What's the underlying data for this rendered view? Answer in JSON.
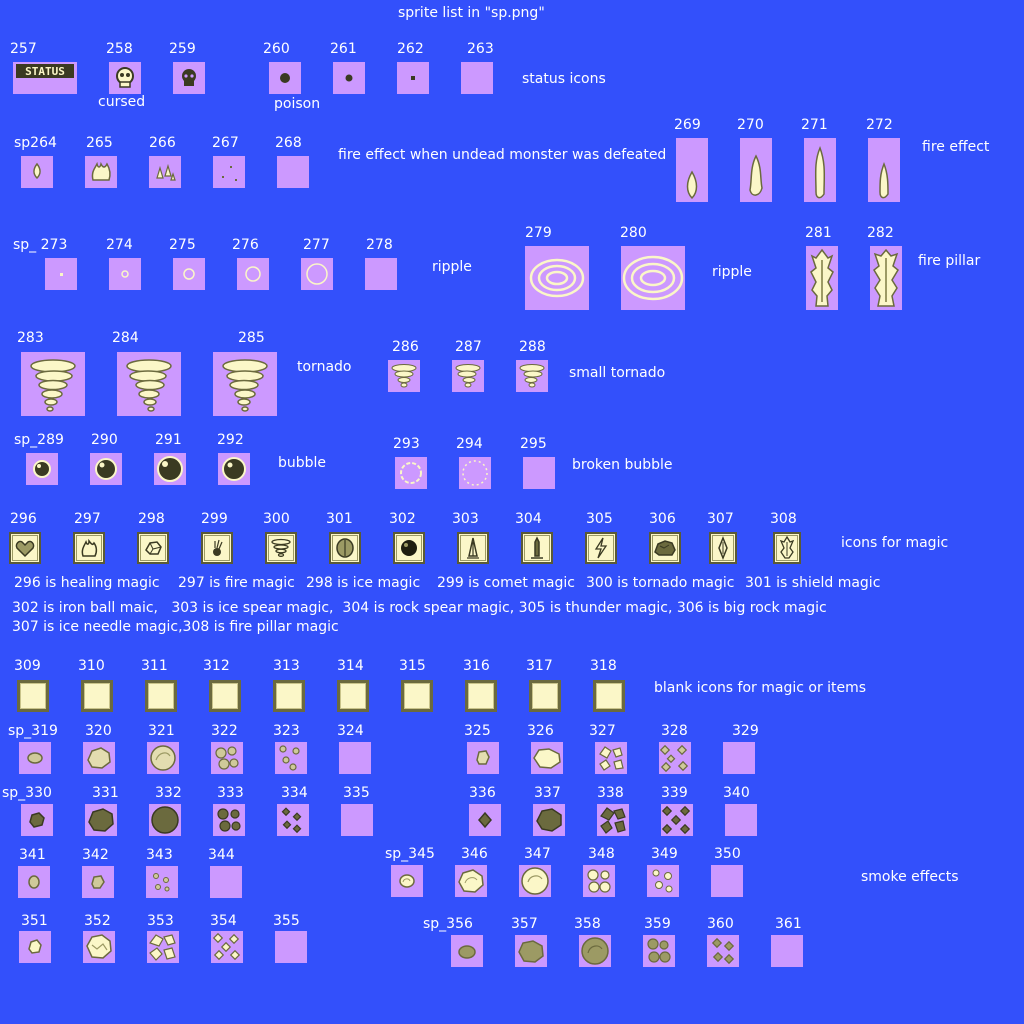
{
  "title": "sprite list in \"sp.png\"",
  "colors": {
    "background": "#3350fb",
    "tile": "#cc99ff",
    "ink": "#3a3a22",
    "pale": "#fbf7c8",
    "olive": "#6b6a3e"
  },
  "sprite_numbers": {
    "n257": "257",
    "n258": "258",
    "n259": "259",
    "n260": "260",
    "n261": "261",
    "n262": "262",
    "n263": "263",
    "n264": "sp264",
    "n265": "265",
    "n266": "266",
    "n267": "267",
    "n268": "268",
    "n269": "269",
    "n270": "270",
    "n271": "271",
    "n272": "272",
    "n273": "sp_ 273",
    "n274": "274",
    "n275": "275",
    "n276": "276",
    "n277": "277",
    "n278": "278",
    "n279": "279",
    "n280": "280",
    "n281": "281",
    "n282": "282",
    "n283": "283",
    "n284": "284",
    "n285": "285",
    "n286": "286",
    "n287": "287",
    "n288": "288",
    "n289": "sp_289",
    "n290": "290",
    "n291": "291",
    "n292": "292",
    "n293": "293",
    "n294": "294",
    "n295": "295",
    "n296": "296",
    "n297": "297",
    "n298": "298",
    "n299": "299",
    "n300": "300",
    "n301": "301",
    "n302": "302",
    "n303": "303",
    "n304": "304",
    "n305": "305",
    "n306": "306",
    "n307": "307",
    "n308": "308",
    "n309": "309",
    "n310": "310",
    "n311": "311",
    "n312": "312",
    "n313": "313",
    "n314": "314",
    "n315": "315",
    "n316": "316",
    "n317": "317",
    "n318": "318",
    "n319": "sp_319",
    "n320": "320",
    "n321": "321",
    "n322": "322",
    "n323": "323",
    "n324": "324",
    "n325": "325",
    "n326": "326",
    "n327": "327",
    "n328": "328",
    "n329": "329",
    "n330": "sp_330",
    "n331": "331",
    "n332": "332",
    "n333": "333",
    "n334": "334",
    "n335": "335",
    "n336": "336",
    "n337": "337",
    "n338": "338",
    "n339": "339",
    "n340": "340",
    "n341": "341",
    "n342": "342",
    "n343": "343",
    "n344": "344",
    "n345": "sp_345",
    "n346": "346",
    "n347": "347",
    "n348": "348",
    "n349": "349",
    "n350": "350",
    "n351": "351",
    "n352": "352",
    "n353": "353",
    "n354": "354",
    "n355": "355",
    "n356": "sp_356",
    "n357": "357",
    "n358": "358",
    "n359": "359",
    "n360": "360",
    "n361": "361"
  },
  "captions": {
    "cursed": "cursed",
    "poison": "poison",
    "status_icons": "status icons",
    "fire_undead": "fire effect when undead monster was defeated",
    "fire_effect": "fire effect",
    "ripple_a": "ripple",
    "ripple_b": "ripple",
    "fire_pillar": "fire pillar",
    "tornado": "tornado",
    "small_tornado": "small tornado",
    "bubble": "bubble",
    "broken_bubble": "broken bubble",
    "icons_for_magic": "icons for magic",
    "blank_icons": "blank icons for magic or items",
    "smoke_effects": "smoke effects",
    "status_glyph_text": "STATUS"
  },
  "magic_notes": {
    "m296": "296 is healing magic",
    "m297": "297 is fire magic",
    "m298": "298 is ice magic",
    "m299": "299 is comet magic",
    "m300": "300 is tornado magic",
    "m301": "301 is shield magic",
    "line2": "302 is iron ball maic,   303 is ice spear magic,  304 is rock spear magic, 305 is thunder magic, 306 is big rock magic",
    "line3": "307 is ice needle magic,308 is fire pillar magic"
  }
}
